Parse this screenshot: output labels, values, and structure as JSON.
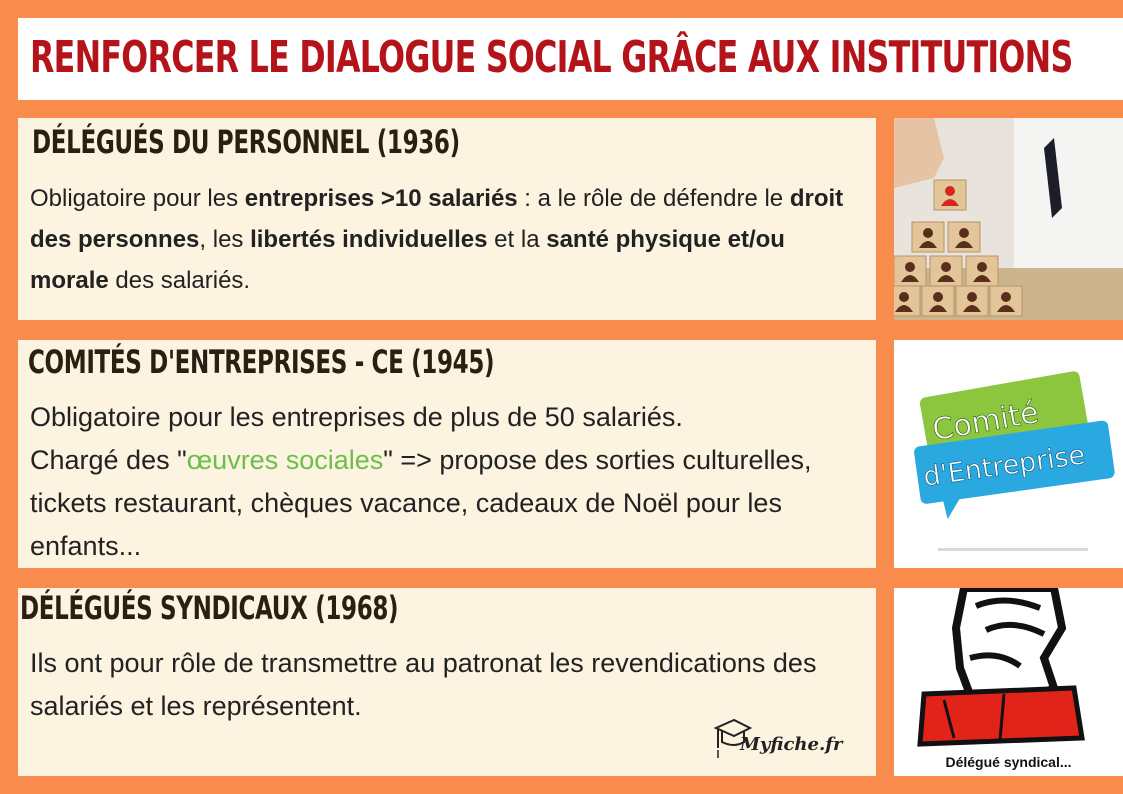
{
  "title": "RENFORCER LE DIALOGUE SOCIAL GRÂCE AUX INSTITUTIONS",
  "sections": [
    {
      "heading": "DÉLÉGUÉS DU PERSONNEL (1936)",
      "body": [
        "Obligatoire pour les ",
        "entreprises >10 salariés",
        " : a le rôle de défendre le ",
        "droit des personnes",
        ", les ",
        "libertés individuelles",
        " et la ",
        "santé physique et/ou morale",
        " des salariés."
      ]
    },
    {
      "heading": "COMITÉS D'ENTREPRISES - CE (1945)",
      "body": [
        "Obligatoire pour les entreprises de plus de 50 salariés.",
        "Chargé des \"",
        "œuvres sociales",
        "\" => propose des sorties culturelles, tickets restaurant, chèques vacance, cadeaux de Noël pour les enfants..."
      ]
    },
    {
      "heading": "DÉLÉGUÉS SYNDICAUX (1968)",
      "body": "Ils ont pour rôle de transmettre au patronat les revendications des salariés et les représentent."
    }
  ],
  "images": {
    "pic1": {
      "icon": "people-blocks-icon"
    },
    "pic2": {
      "line1": "Comité",
      "line2": "d'Entreprise"
    },
    "pic3": {
      "icon": "raised-fist-icon",
      "caption": "Délégué syndical..."
    }
  },
  "logo": {
    "text": "Myfiche.fr",
    "icon": "graduation-cap-icon"
  },
  "colors": {
    "background": "#f98b4c",
    "title": "#b5131a",
    "card": "#fcf3e1",
    "accent_green": "#6cbf4a",
    "bubble_blue": "#2aa8e0",
    "bubble_green": "#8cc63e",
    "fist_red": "#e2231a"
  }
}
